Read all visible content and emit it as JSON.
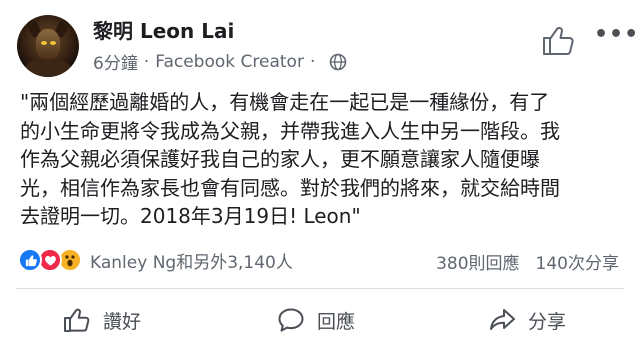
{
  "post": {
    "author": "黎明 Leon Lai",
    "time": "6分鐘",
    "role": "Facebook Creator",
    "separator": "·",
    "privacy_icon": "globe-icon",
    "header_like_icon": "thumbs-up-icon",
    "more_icon": "more-horizontal-icon",
    "more_label": "•••",
    "text_lines": [
      "\"兩個經歷過離婚的人，有機會走在一起已是一種緣份，有了",
      "的小生命更將令我成為父親，并帶我進入人生中另一階段。我",
      "作為父親必須保護好我自己的家人，更不願意讓家人隨便曝",
      "光，相信作為家長也會有同感。對於我們的將來，就交給時間",
      "去證明一切。2018年3月19日! Leon\""
    ]
  },
  "engagement": {
    "reaction_icons": [
      "like-reaction-icon",
      "love-reaction-icon",
      "wow-reaction-icon"
    ],
    "reactors": "Kanley Ng和另外3,140人",
    "comments": "380則回應",
    "shares": "140次分享"
  },
  "actions": {
    "like": "讚好",
    "comment": "回應",
    "share": "分享"
  },
  "colors": {
    "like_blue": "#1877f2",
    "love_red": "#f0284a",
    "wow_yellow": "#f7b125",
    "secondary_text": "#606770"
  }
}
